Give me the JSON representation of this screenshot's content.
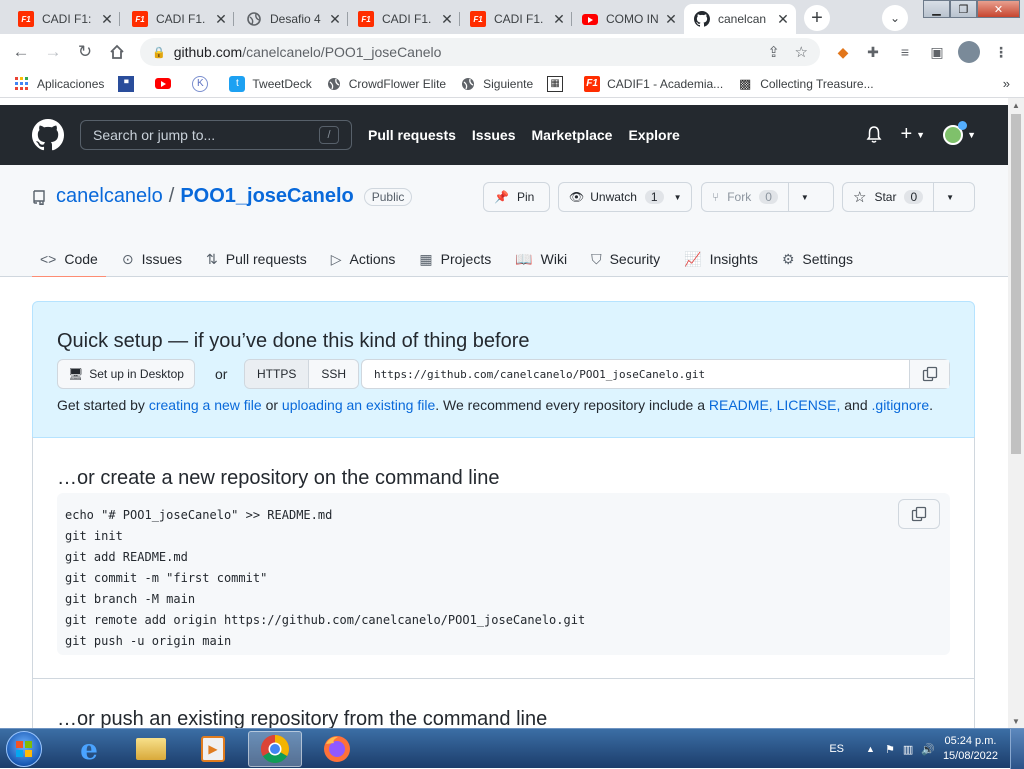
{
  "browser": {
    "tabs": [
      {
        "title": "CADI F1:",
        "icon": "cadi-f1-icon"
      },
      {
        "title": "CADI F1.",
        "icon": "cadi-f1-icon"
      },
      {
        "title": "Desafio 4",
        "icon": "globe-icon"
      },
      {
        "title": "CADI F1.",
        "icon": "cadi-f1-icon"
      },
      {
        "title": "CADI F1.",
        "icon": "cadi-f1-icon"
      },
      {
        "title": "COMO IN",
        "icon": "youtube-icon"
      },
      {
        "title": "canelcan",
        "icon": "github-icon"
      }
    ],
    "url_host": "github.com",
    "url_path": "/canelcanelo/POO1_joseCanelo"
  },
  "bookmarks": [
    {
      "label": "Aplicaciones",
      "icon": "apps-grid-icon"
    },
    {
      "label": "",
      "icon": "bookmark-badge-icon"
    },
    {
      "label": "",
      "icon": "youtube-icon"
    },
    {
      "label": "",
      "icon": "k-circle-icon"
    },
    {
      "label": "TweetDeck",
      "icon": "tweetdeck-icon"
    },
    {
      "label": "CrowdFlower Elite",
      "icon": "globe-icon"
    },
    {
      "label": "Siguiente",
      "icon": "globe-icon"
    },
    {
      "label": "",
      "icon": "bookmark-square-icon"
    },
    {
      "label": "CADIF1 - Academia...",
      "icon": "cadi-f1-icon"
    },
    {
      "label": "Collecting Treasure...",
      "icon": "qr-icon"
    }
  ],
  "github": {
    "search_placeholder": "Search or jump to...",
    "search_shortcut": "/",
    "nav": [
      "Pull requests",
      "Issues",
      "Marketplace",
      "Explore"
    ]
  },
  "repo": {
    "owner": "canelcanelo",
    "separator": "/",
    "name": "POO1_joseCanelo",
    "visibility": "Public",
    "pin_label": "Pin",
    "watch_label": "Unwatch",
    "watch_count": "1",
    "fork_label": "Fork",
    "fork_count": "0",
    "star_label": "Star",
    "star_count": "0",
    "tabs": [
      {
        "label": "Code",
        "icon": "code-icon",
        "active": true
      },
      {
        "label": "Issues",
        "icon": "issue-icon"
      },
      {
        "label": "Pull requests",
        "icon": "pull-request-icon"
      },
      {
        "label": "Actions",
        "icon": "play-icon"
      },
      {
        "label": "Projects",
        "icon": "table-icon"
      },
      {
        "label": "Wiki",
        "icon": "book-icon"
      },
      {
        "label": "Security",
        "icon": "shield-icon"
      },
      {
        "label": "Insights",
        "icon": "graph-icon"
      },
      {
        "label": "Settings",
        "icon": "gear-icon"
      }
    ]
  },
  "quick_setup": {
    "title": "Quick setup — if you’ve done this kind of thing before",
    "desktop_button": "Set up in Desktop",
    "or": "or",
    "https": "HTTPS",
    "ssh": "SSH",
    "clone_url": "https://github.com/canelcanelo/POO1_joseCanelo.git",
    "hint_prefix": "Get started by",
    "link_new_file": "creating a new file",
    "hint_or": "or",
    "link_upload": "uploading an existing file",
    "hint_mid": ". We recommend every repository include a",
    "link_readme": "README, LICENSE,",
    "hint_and": "and",
    "link_gitignore": ".gitignore",
    "hint_end": "."
  },
  "create_section": {
    "title": "…or create a new repository on the command line",
    "commands": [
      "echo \"# POO1_joseCanelo\" >> README.md",
      "git init",
      "git add README.md",
      "git commit -m \"first commit\"",
      "git branch -M main",
      "git remote add origin https://github.com/canelcanelo/POO1_joseCanelo.git",
      "git push -u origin main"
    ]
  },
  "push_section": {
    "title": "…or push an existing repository from the command line"
  },
  "taskbar": {
    "language": "ES",
    "time": "05:24 p.m.",
    "date": "15/08/2022"
  },
  "colors": {
    "github_header": "#24292f",
    "link": "#0969da",
    "quick_setup_bg": "#ddf4ff",
    "active_tab_underline": "#fd8c73"
  }
}
